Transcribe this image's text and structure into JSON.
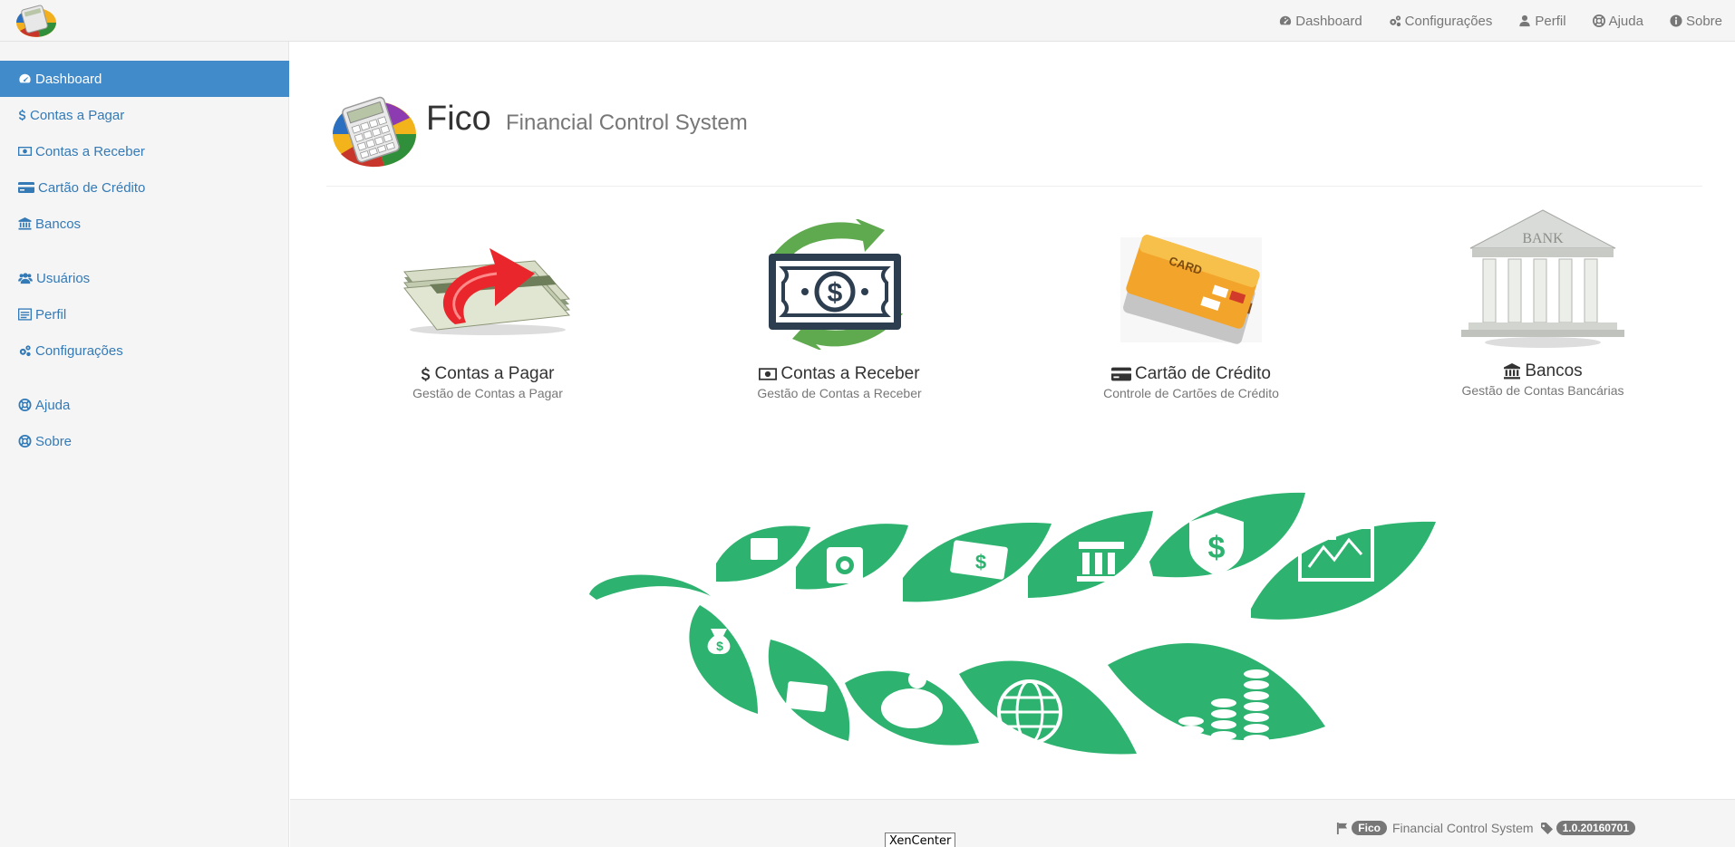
{
  "navbar": {
    "items": [
      {
        "label": "Dashboard",
        "icon": "dashboard-icon"
      },
      {
        "label": "Configurações",
        "icon": "gears-icon"
      },
      {
        "label": "Perfil",
        "icon": "user-icon"
      },
      {
        "label": "Ajuda",
        "icon": "lifebuoy-icon"
      },
      {
        "label": "Sobre",
        "icon": "info-icon"
      }
    ]
  },
  "sidebar": {
    "items": [
      {
        "label": "Dashboard",
        "icon": "dashboard-icon",
        "active": true
      },
      {
        "label": "Contas a Pagar",
        "icon": "dollar-icon"
      },
      {
        "label": "Contas a Receber",
        "icon": "money-icon"
      },
      {
        "label": "Cartão de Crédito",
        "icon": "credit-card-icon"
      },
      {
        "label": "Bancos",
        "icon": "bank-icon"
      },
      {
        "label": "Usuários",
        "icon": "users-icon"
      },
      {
        "label": "Perfil",
        "icon": "profile-icon"
      },
      {
        "label": "Configurações",
        "icon": "gears-icon"
      },
      {
        "label": "Ajuda",
        "icon": "lifebuoy-icon"
      },
      {
        "label": "Sobre",
        "icon": "lifebuoy-icon"
      }
    ]
  },
  "header": {
    "app_name": "Fico",
    "subtitle": "Financial Control System"
  },
  "cards": [
    {
      "title": "Contas a Pagar",
      "desc": "Gestão de Contas a Pagar",
      "icon": "dollar-icon"
    },
    {
      "title": "Contas a Receber",
      "desc": "Gestão de Contas a Receber",
      "icon": "money-icon"
    },
    {
      "title": "Cartão de Crédito",
      "desc": "Controle de Cartões de Crédito",
      "icon": "credit-card-icon"
    },
    {
      "title": "Bancos",
      "desc": "Gestão de Contas Bancárias",
      "icon": "bank-icon"
    }
  ],
  "card_image_text": {
    "card": "CARD",
    "bank": "BANK"
  },
  "footer": {
    "brand_badge": "Fico",
    "system_name": "Financial Control System",
    "version": "1.0.20160701",
    "tooltip": "XenCenter"
  },
  "colors": {
    "primary": "#428bca",
    "link": "#337ab7",
    "leaf_green": "#2db36f",
    "arrow_red": "#e8262b"
  }
}
